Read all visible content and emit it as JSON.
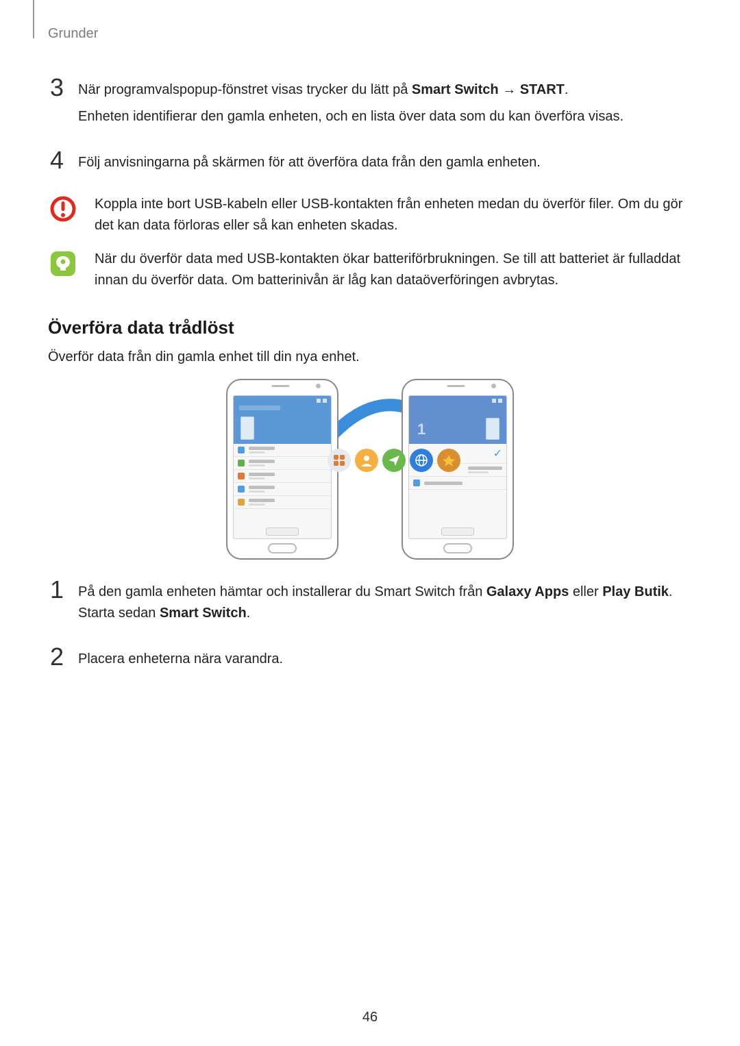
{
  "header": {
    "chapter": "Grunder"
  },
  "steps_top": {
    "s3": {
      "num": "3",
      "p1_pre": "När programvalspopup-fönstret visas trycker du lätt på ",
      "p1_b1": "Smart Switch",
      "p1_arrow": " → ",
      "p1_b2": "START",
      "p1_post": ".",
      "p2": "Enheten identifierar den gamla enheten, och en lista över data som du kan överföra visas."
    },
    "s4": {
      "num": "4",
      "p1": "Följ anvisningarna på skärmen för att överföra data från den gamla enheten."
    }
  },
  "callouts": {
    "warn": "Koppla inte bort USB-kabeln eller USB-kontakten från enheten medan du överför filer. Om du gör det kan data förloras eller så kan enheten skadas.",
    "note": "När du överför data med USB-kontakten ökar batteriförbrukningen. Se till att batteriet är fulladdat innan du överför data. Om batterinivån är låg kan dataöverföringen avbrytas."
  },
  "section": {
    "title": "Överföra data trådlöst",
    "intro": "Överför data från din gamla enhet till din nya enhet."
  },
  "steps_bottom": {
    "s1": {
      "num": "1",
      "p1_pre": "På den gamla enheten hämtar och installerar du Smart Switch från ",
      "p1_b1": "Galaxy Apps",
      "p1_mid": " eller ",
      "p1_b2": "Play Butik",
      "p1_mid2": ". Starta sedan ",
      "p1_b3": "Smart Switch",
      "p1_post": "."
    },
    "s2": {
      "num": "2",
      "p1": "Placera enheterna nära varandra."
    }
  },
  "page_number": "46",
  "illus": {
    "left_rows": [
      {
        "color": "#4f9de6"
      },
      {
        "color": "#62b04b"
      },
      {
        "color": "#e07a3a"
      },
      {
        "color": "#4f9de6"
      },
      {
        "color": "#dfa23f"
      }
    ]
  }
}
